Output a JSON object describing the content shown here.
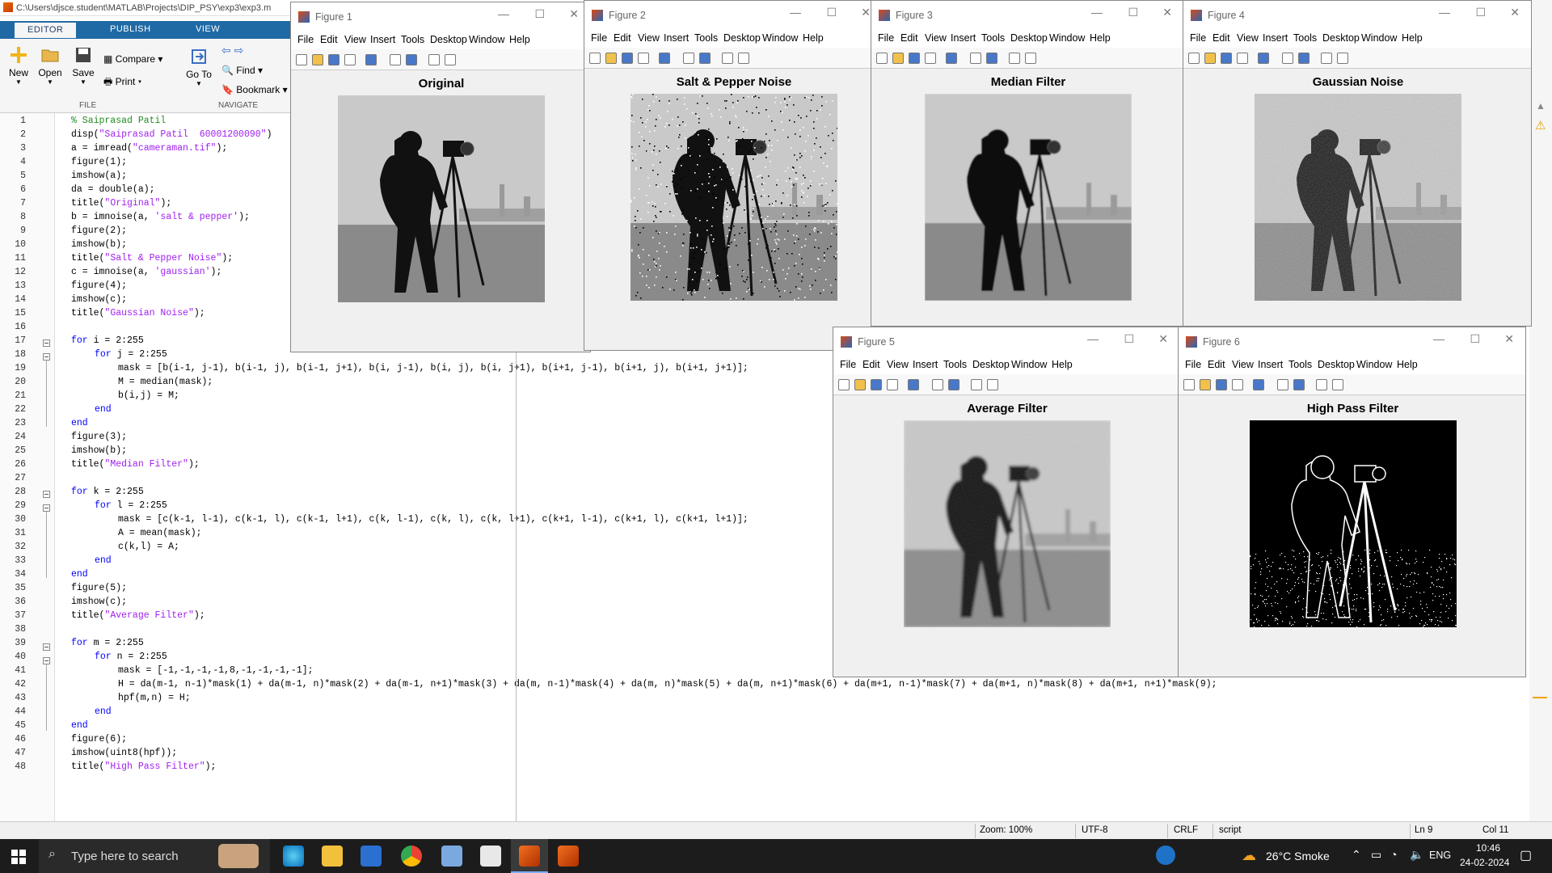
{
  "editor": {
    "path": "C:\\Users\\djsce.student\\MATLAB\\Projects\\DIP_PSY\\exp3\\exp3.m",
    "tabs": [
      "EDITOR",
      "PUBLISH",
      "VIEW"
    ],
    "ribbon": {
      "new": "New",
      "open": "Open",
      "save": "Save",
      "compare": "Compare",
      "print": "Print",
      "goto": "Go To",
      "find": "Find",
      "bookmark": "Bookmark",
      "file_group": "FILE",
      "navigate_group": "NAVIGATE"
    },
    "line_numbers": [
      "1",
      "2",
      "3",
      "4",
      "5",
      "6",
      "7",
      "8",
      "9",
      "10",
      "11",
      "12",
      "13",
      "14",
      "15",
      "16",
      "17",
      "18",
      "19",
      "20",
      "21",
      "22",
      "23",
      "24",
      "25",
      "26",
      "27",
      "28",
      "29",
      "30",
      "31",
      "32",
      "33",
      "34",
      "35",
      "36",
      "37",
      "38",
      "39",
      "40",
      "41",
      "42",
      "43",
      "44",
      "45",
      "46",
      "47",
      "48"
    ],
    "code": [
      {
        "i": 0,
        "p": [
          [
            "com",
            "% Saiprasad Patil"
          ]
        ]
      },
      {
        "i": 0,
        "p": [
          [
            "n",
            "disp("
          ],
          [
            "str",
            "\"Saiprasad Patil  60001200090\""
          ],
          [
            "n",
            ")"
          ]
        ]
      },
      {
        "i": 0,
        "p": [
          [
            "n",
            "a = imread("
          ],
          [
            "str",
            "\"cameraman.tif\""
          ],
          [
            "n",
            ");"
          ]
        ]
      },
      {
        "i": 0,
        "p": [
          [
            "n",
            "figure(1);"
          ]
        ]
      },
      {
        "i": 0,
        "p": [
          [
            "n",
            "imshow(a);"
          ]
        ]
      },
      {
        "i": 0,
        "p": [
          [
            "n",
            "da = double(a);"
          ]
        ]
      },
      {
        "i": 0,
        "p": [
          [
            "n",
            "title("
          ],
          [
            "str",
            "\"Original\""
          ],
          [
            "n",
            ");"
          ]
        ]
      },
      {
        "i": 0,
        "p": [
          [
            "n",
            "b = imnoise(a, "
          ],
          [
            "str",
            "'salt & pepper'"
          ],
          [
            "n",
            ");"
          ]
        ]
      },
      {
        "i": 0,
        "p": [
          [
            "n",
            "figure(2);"
          ]
        ]
      },
      {
        "i": 0,
        "p": [
          [
            "n",
            "imshow(b);"
          ]
        ]
      },
      {
        "i": 0,
        "p": [
          [
            "n",
            "title("
          ],
          [
            "str",
            "\"Salt & Pepper Noise\""
          ],
          [
            "n",
            ");"
          ]
        ]
      },
      {
        "i": 0,
        "p": [
          [
            "n",
            "c = imnoise(a, "
          ],
          [
            "str",
            "'gaussian'"
          ],
          [
            "n",
            ");"
          ]
        ]
      },
      {
        "i": 0,
        "p": [
          [
            "n",
            "figure(4);"
          ]
        ]
      },
      {
        "i": 0,
        "p": [
          [
            "n",
            "imshow(c);"
          ]
        ]
      },
      {
        "i": 0,
        "p": [
          [
            "n",
            "title("
          ],
          [
            "str",
            "\"Gaussian Noise\""
          ],
          [
            "n",
            ");"
          ]
        ]
      },
      {
        "i": 0,
        "p": []
      },
      {
        "i": 0,
        "p": [
          [
            "kw",
            "for"
          ],
          [
            "n",
            " i = 2:255"
          ]
        ]
      },
      {
        "i": 1,
        "p": [
          [
            "kw",
            "for"
          ],
          [
            "n",
            " j = 2:255"
          ]
        ]
      },
      {
        "i": 2,
        "p": [
          [
            "n",
            "mask = [b(i-1, j-1), b(i-1, j), b(i-1, j+1), b(i, j-1), b(i, j), b(i, j+1), b(i+1, j-1), b(i+1, j), b(i+1, j+1)];"
          ]
        ]
      },
      {
        "i": 2,
        "p": [
          [
            "n",
            "M = median(mask);"
          ]
        ]
      },
      {
        "i": 2,
        "p": [
          [
            "n",
            "b(i,j) = M;"
          ]
        ]
      },
      {
        "i": 1,
        "p": [
          [
            "kw",
            "end"
          ]
        ]
      },
      {
        "i": 0,
        "p": [
          [
            "kw",
            "end"
          ]
        ]
      },
      {
        "i": 0,
        "p": [
          [
            "n",
            "figure(3);"
          ]
        ]
      },
      {
        "i": 0,
        "p": [
          [
            "n",
            "imshow(b);"
          ]
        ]
      },
      {
        "i": 0,
        "p": [
          [
            "n",
            "title("
          ],
          [
            "str",
            "\"Median Filter\""
          ],
          [
            "n",
            ");"
          ]
        ]
      },
      {
        "i": 0,
        "p": []
      },
      {
        "i": 0,
        "p": [
          [
            "kw",
            "for"
          ],
          [
            "n",
            " k = 2:255"
          ]
        ]
      },
      {
        "i": 1,
        "p": [
          [
            "kw",
            "for"
          ],
          [
            "n",
            " l = 2:255"
          ]
        ]
      },
      {
        "i": 2,
        "p": [
          [
            "n",
            "mask = [c(k-1, l-1), c(k-1, l), c(k-1, l+1), c(k, l-1), c(k, l), c(k, l+1), c(k+1, l-1), c(k+1, l), c(k+1, l+1)];"
          ]
        ]
      },
      {
        "i": 2,
        "p": [
          [
            "n",
            "A = mean(mask);"
          ]
        ]
      },
      {
        "i": 2,
        "p": [
          [
            "n",
            "c(k,l) = A;"
          ]
        ]
      },
      {
        "i": 1,
        "p": [
          [
            "kw",
            "end"
          ]
        ]
      },
      {
        "i": 0,
        "p": [
          [
            "kw",
            "end"
          ]
        ]
      },
      {
        "i": 0,
        "p": [
          [
            "n",
            "figure(5);"
          ]
        ]
      },
      {
        "i": 0,
        "p": [
          [
            "n",
            "imshow(c);"
          ]
        ]
      },
      {
        "i": 0,
        "p": [
          [
            "n",
            "title("
          ],
          [
            "str",
            "\"Average Filter\""
          ],
          [
            "n",
            ");"
          ]
        ]
      },
      {
        "i": 0,
        "p": []
      },
      {
        "i": 0,
        "p": [
          [
            "kw",
            "for"
          ],
          [
            "n",
            " m = 2:255"
          ]
        ]
      },
      {
        "i": 1,
        "p": [
          [
            "kw",
            "for"
          ],
          [
            "n",
            " n = 2:255"
          ]
        ]
      },
      {
        "i": 2,
        "p": [
          [
            "n",
            "mask = [-1,-1,-1,-1,8,-1,-1,-1,-1];"
          ]
        ]
      },
      {
        "i": 2,
        "p": [
          [
            "n",
            "H = da(m-1, n-1)*mask(1) + da(m-1, n)*mask(2) + da(m-1, n+1)*mask(3) + da(m, n-1)*mask(4) + da(m, n)*mask(5) + da(m, n+1)*mask(6) + da(m+1, n-1)*mask(7) + da(m+1, n)*mask(8) + da(m+1, n+1)*mask(9);"
          ]
        ]
      },
      {
        "i": 2,
        "p": [
          [
            "n",
            "hpf(m,n) = H;"
          ]
        ]
      },
      {
        "i": 1,
        "p": [
          [
            "kw",
            "end"
          ]
        ]
      },
      {
        "i": 0,
        "p": [
          [
            "kw",
            "end"
          ]
        ]
      },
      {
        "i": 0,
        "p": [
          [
            "n",
            "figure(6);"
          ]
        ]
      },
      {
        "i": 0,
        "p": [
          [
            "n",
            "imshow(uint8(hpf));"
          ]
        ]
      },
      {
        "i": 0,
        "p": [
          [
            "n",
            "title("
          ],
          [
            "str",
            "\"High Pass Filter\""
          ],
          [
            "n",
            ");"
          ]
        ]
      }
    ]
  },
  "figure_menu": [
    "File",
    "Edit",
    "View",
    "Insert",
    "Tools",
    "Desktop",
    "Window",
    "Help"
  ],
  "figures": [
    {
      "window_title": "Figure 1",
      "plot_title": "Original",
      "variant": "original"
    },
    {
      "window_title": "Figure 2",
      "plot_title": "Salt & Pepper Noise",
      "variant": "saltpepper"
    },
    {
      "window_title": "Figure 3",
      "plot_title": "Median Filter",
      "variant": "median"
    },
    {
      "window_title": "Figure 4",
      "plot_title": "Gaussian Noise",
      "variant": "gaussian"
    },
    {
      "window_title": "Figure 5",
      "plot_title": "Average Filter",
      "variant": "average"
    },
    {
      "window_title": "Figure 6",
      "plot_title": "High Pass Filter",
      "variant": "highpass"
    }
  ],
  "status_bar": {
    "zoom": "Zoom: 100%",
    "encoding": "UTF-8",
    "line_ending": "CRLF",
    "type": "script",
    "ln": "Ln  9",
    "col": "Col  11"
  },
  "taskbar": {
    "search_placeholder": "Type here to search",
    "weather": "26°C  Smoke",
    "lang": "ENG",
    "time": "10:46",
    "date": "24-02-2024"
  }
}
